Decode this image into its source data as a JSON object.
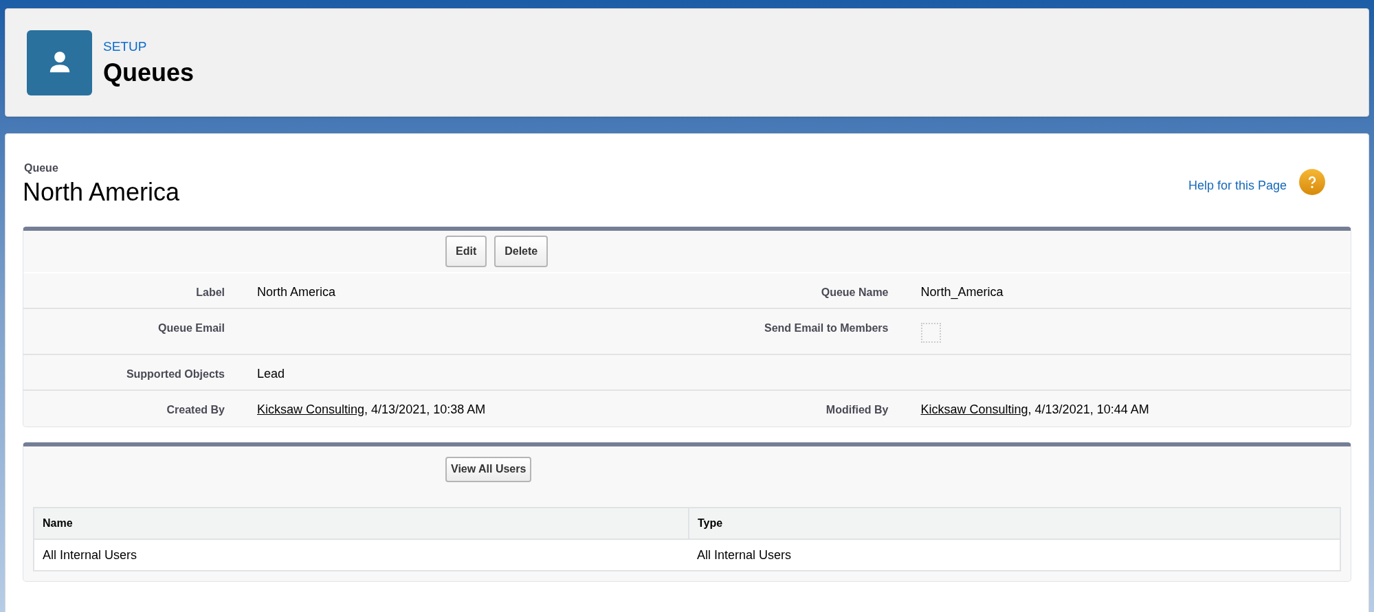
{
  "header": {
    "eyebrow": "SETUP",
    "title": "Queues"
  },
  "record": {
    "type_label": "Queue",
    "name": "North America",
    "help_link": "Help for this Page"
  },
  "detail": {
    "buttons": [
      "Edit",
      "Delete"
    ],
    "rows": [
      {
        "left": {
          "label": "Label",
          "kind": "text",
          "value": "North America"
        },
        "right": {
          "label": "Queue Name",
          "kind": "text",
          "value": "North_America"
        }
      },
      {
        "left": {
          "label": "Queue Email",
          "kind": "empty"
        },
        "right": {
          "label": "Send Email to Members",
          "kind": "checkbox",
          "checked": false
        }
      },
      {
        "left": {
          "label": "Supported Objects",
          "kind": "text",
          "value": "Lead"
        },
        "right": {
          "kind": "empty"
        }
      },
      {
        "left": {
          "label": "Created By",
          "kind": "link",
          "link": "Kicksaw Consulting",
          "value": ", 4/13/2021, 10:38 AM"
        },
        "right": {
          "label": "Modified By",
          "kind": "link",
          "link": "Kicksaw Consulting",
          "value": ", 4/13/2021, 10:44 AM"
        }
      }
    ]
  },
  "members": {
    "button": "View All Users",
    "table": {
      "columns": [
        "Name",
        "Type"
      ],
      "rows": [
        [
          "All Internal Users",
          "All Internal Users"
        ]
      ]
    }
  }
}
